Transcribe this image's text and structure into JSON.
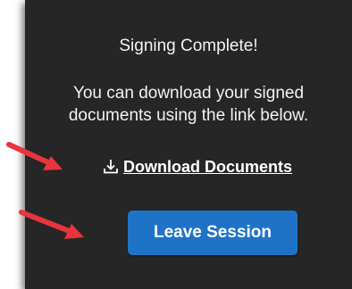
{
  "dialog": {
    "title": "Signing Complete!",
    "message_line_1": "You can download your signed",
    "message_line_2": "documents using the link below.",
    "download_link_label": "Download Documents",
    "download_icon": "download-icon",
    "leave_button_label": "Leave Session"
  },
  "annotations": {
    "arrow_icon": "red-arrow-icon",
    "arrow_color": "#e8343c"
  },
  "colors": {
    "dialog_background": "#262626",
    "button_background": "#1f73c7",
    "text": "#f2f2f2"
  }
}
